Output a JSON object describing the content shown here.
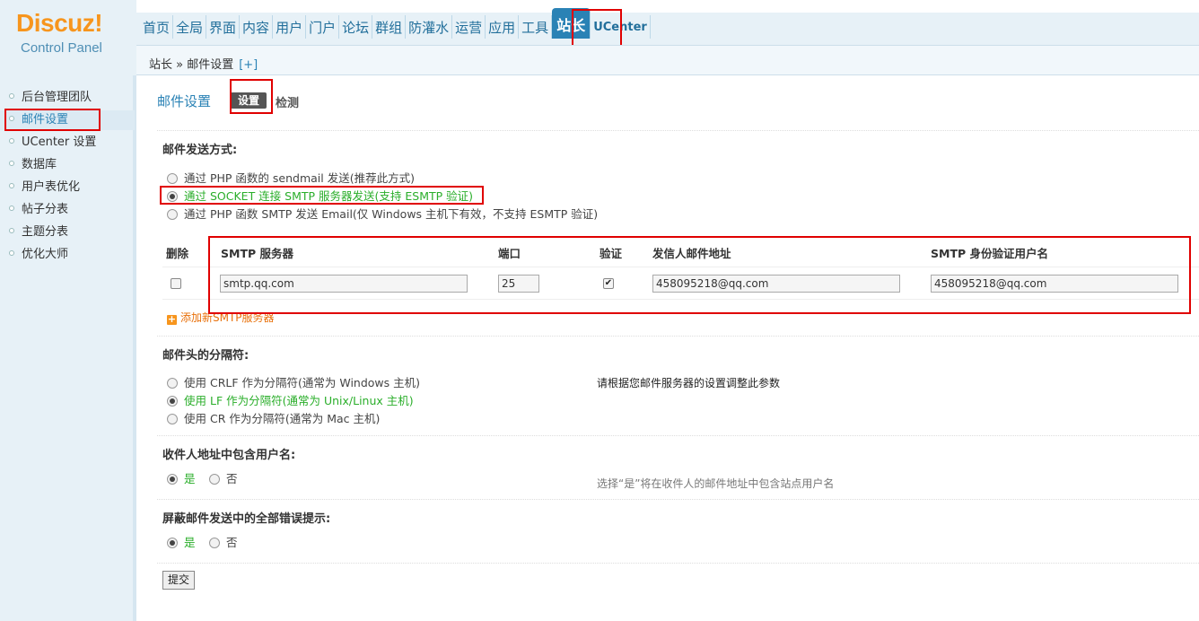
{
  "logo": {
    "main": "Discuz!",
    "sub": "Control Panel"
  },
  "nav": [
    {
      "label": "首页"
    },
    {
      "label": "全局"
    },
    {
      "label": "界面"
    },
    {
      "label": "内容"
    },
    {
      "label": "用户"
    },
    {
      "label": "门户"
    },
    {
      "label": "论坛"
    },
    {
      "label": "群组"
    },
    {
      "label": "防灌水"
    },
    {
      "label": "运营"
    },
    {
      "label": "应用"
    },
    {
      "label": "工具"
    },
    {
      "label": "站长"
    },
    {
      "label": "UCenter"
    }
  ],
  "breadcrumb": {
    "text": "站长 » 邮件设置",
    "plus": "[+]"
  },
  "sidebar": [
    {
      "label": "后台管理团队"
    },
    {
      "label": "邮件设置"
    },
    {
      "label": "UCenter 设置"
    },
    {
      "label": "数据库"
    },
    {
      "label": "用户表优化"
    },
    {
      "label": "帖子分表"
    },
    {
      "label": "主题分表"
    },
    {
      "label": "优化大师"
    }
  ],
  "page": {
    "title": "邮件设置",
    "tab_set": "设置",
    "tab_check": "检测"
  },
  "mail_method": {
    "title": "邮件发送方式:",
    "options": [
      {
        "label": "通过 PHP 函数的 sendmail 发送(推荐此方式)",
        "checked": false
      },
      {
        "label": "通过 SOCKET 连接 SMTP 服务器发送(支持 ESMTP 验证)",
        "checked": true
      },
      {
        "label": "通过 PHP 函数 SMTP 发送 Email(仅 Windows 主机下有效，不支持 ESMTP 验证)",
        "checked": false
      }
    ]
  },
  "smtp_table": {
    "headers": {
      "delete": "删除",
      "server": "SMTP 服务器",
      "port": "端口",
      "auth": "验证",
      "from": "发信人邮件地址",
      "auth_user": "SMTP 身份验证用户名"
    },
    "row": {
      "server": "smtp.qq.com",
      "port": "25",
      "auth_checked": true,
      "from": "458095218@qq.com",
      "auth_user": "458095218@qq.com"
    },
    "add_label": "添加新SMTP服务器"
  },
  "separator": {
    "title": "邮件头的分隔符:",
    "options": [
      {
        "label": "使用 CRLF 作为分隔符(通常为 Windows 主机)",
        "checked": false
      },
      {
        "label": "使用 LF 作为分隔符(通常为 Unix/Linux 主机)",
        "checked": true
      },
      {
        "label": "使用 CR 作为分隔符(通常为 Mac 主机)",
        "checked": false
      }
    ],
    "tip": "请根据您邮件服务器的设置调整此参数"
  },
  "include_username": {
    "title": "收件人地址中包含用户名:",
    "yes": "是",
    "no": "否",
    "tip": "选择“是”将在收件人的邮件地址中包含站点用户名"
  },
  "silent": {
    "title": "屏蔽邮件发送中的全部错误提示:",
    "yes": "是",
    "no": "否"
  },
  "submit_label": "提交",
  "colors": {
    "accent": "#2a82b5",
    "logo": "#f7951d",
    "selected_option": "#2aae2a",
    "highlight_box": "#e00000"
  }
}
